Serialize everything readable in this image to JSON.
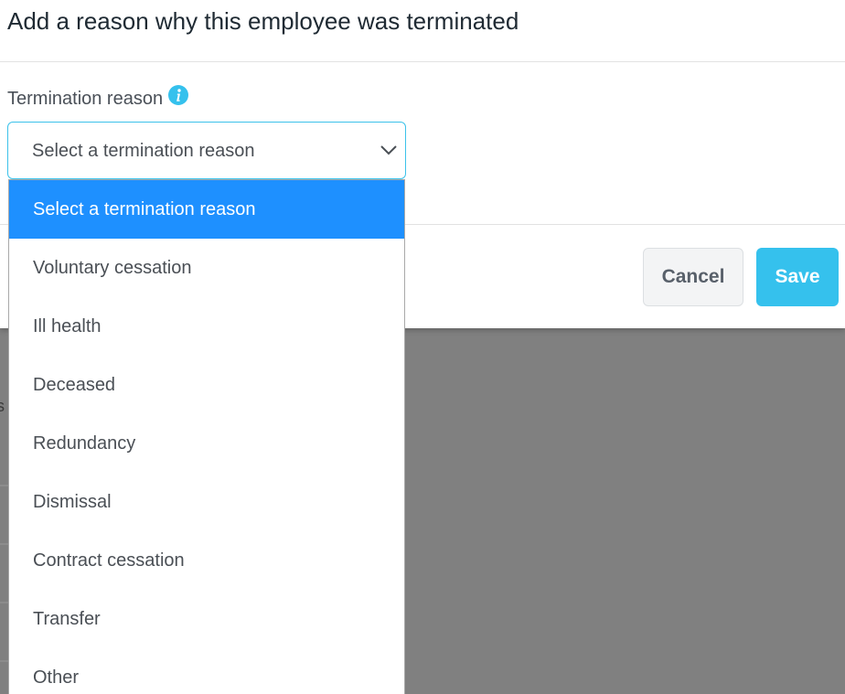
{
  "modal": {
    "title": "Add a reason why this employee was terminated",
    "field_label": "Termination reason",
    "select": {
      "value": "Select a termination reason"
    },
    "buttons": {
      "cancel_label": "Cancel",
      "save_label": "Save"
    }
  },
  "dropdown": {
    "options": [
      "Select a termination reason",
      "Voluntary cessation",
      "Ill health",
      "Deceased",
      "Redundancy",
      "Dismissal",
      "Contract cessation",
      "Transfer",
      "Other"
    ],
    "highlighted_index": 0
  },
  "colors": {
    "accent": "#35c1ed",
    "highlight": "#1e90ff",
    "overlay": "#808080"
  },
  "icons": {
    "info": "info-icon",
    "chevron": "chevron-down-icon"
  }
}
